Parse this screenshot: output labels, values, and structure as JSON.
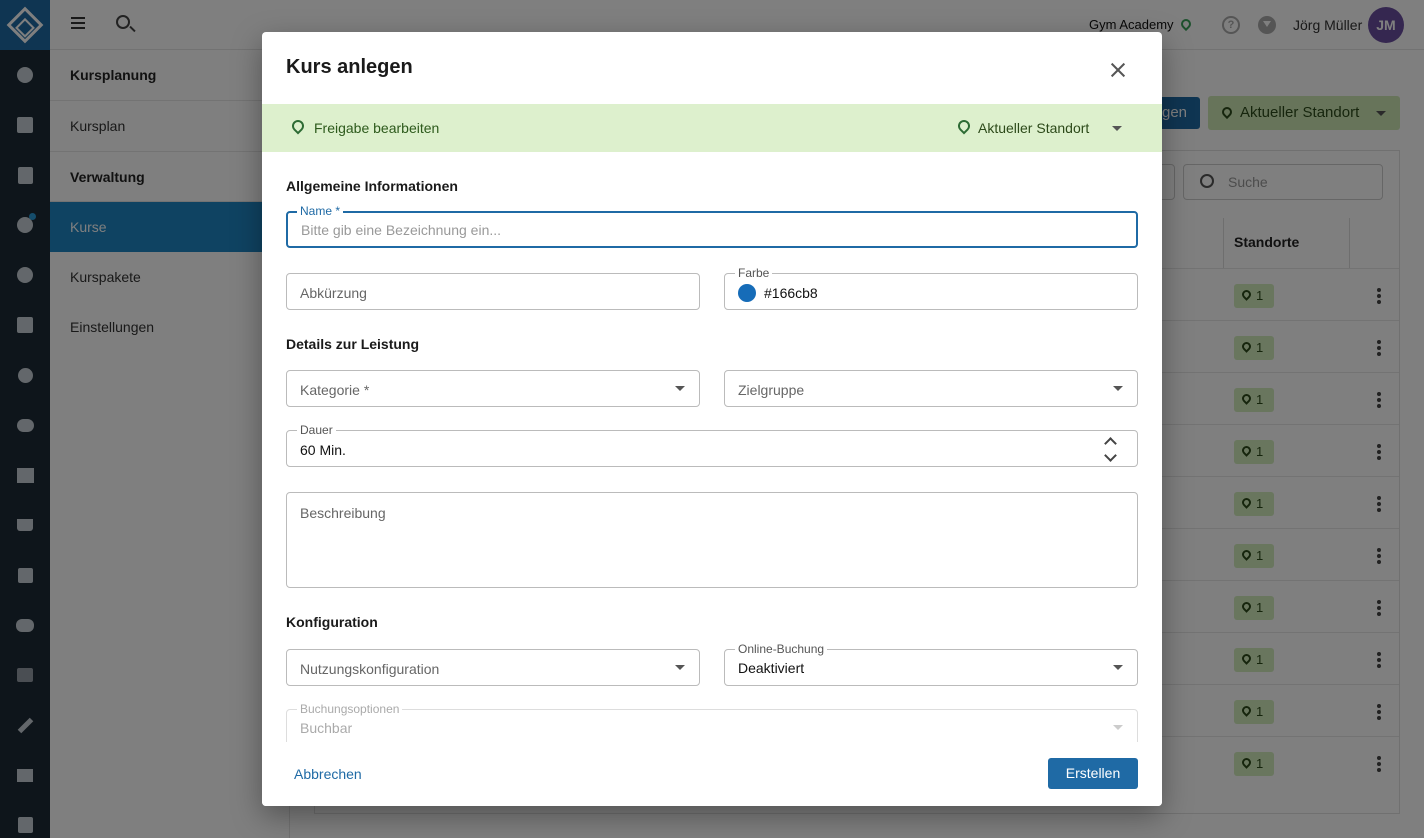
{
  "topbar": {
    "studio": "Gym Academy",
    "help_label": "?",
    "user_name": "Jörg Müller",
    "avatar_initials": "JM"
  },
  "subnav": {
    "sections": [
      {
        "label": "Kursplanung",
        "items": [
          "Kursplan"
        ]
      },
      {
        "label": "Verwaltung",
        "items": [
          "Kurse",
          "Kurspakete",
          "Einstellungen"
        ]
      }
    ],
    "active_item": "Kurse"
  },
  "background": {
    "primary_button_partial": "gen",
    "location_button": "Aktueller Standort",
    "search_placeholder": "Suche",
    "column_header": "Standorte",
    "location_chip_value": "1"
  },
  "modal": {
    "title": "Kurs anlegen",
    "share_bar": {
      "left_label": "Freigabe bearbeiten",
      "right_label": "Aktueller Standort"
    },
    "sections": {
      "general": "Allgemeine Informationen",
      "details": "Details zur Leistung",
      "config": "Konfiguration"
    },
    "fields": {
      "name": {
        "legend": "Name *",
        "placeholder": "Bitte gib eine Bezeichnung ein...",
        "value": ""
      },
      "abbreviation": {
        "placeholder": "Abkürzung"
      },
      "color": {
        "legend": "Farbe",
        "value": "#166cb8"
      },
      "category": {
        "placeholder": "Kategorie *"
      },
      "target_group": {
        "placeholder": "Zielgruppe"
      },
      "duration": {
        "legend": "Dauer",
        "value": "60 Min."
      },
      "description": {
        "placeholder": "Beschreibung"
      },
      "usage_config": {
        "placeholder": "Nutzungskonfiguration"
      },
      "online_booking": {
        "legend": "Online-Buchung",
        "value": "Deaktiviert"
      },
      "booking_options": {
        "legend": "Buchungsoptionen",
        "value": "Buchbar"
      }
    },
    "footer": {
      "cancel": "Abbrechen",
      "create": "Erstellen"
    }
  },
  "colors": {
    "primary": "#1f6aa5",
    "share_bar_bg": "#ddf0cd",
    "course_color": "#166cb8",
    "rail_bg": "#1d2b36"
  }
}
